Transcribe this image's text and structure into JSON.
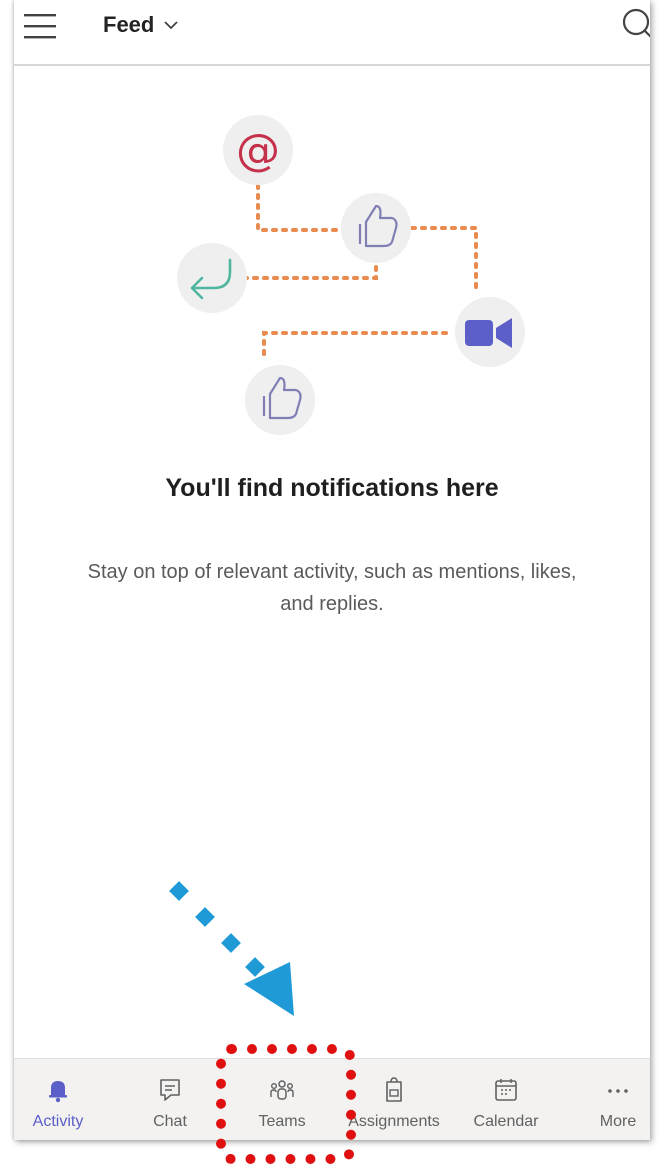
{
  "header": {
    "title": "Feed"
  },
  "empty_state": {
    "title": "You'll find notifications here",
    "description": "Stay on top of relevant activity, such as mentions, likes, and replies."
  },
  "tabs": [
    {
      "label": "Activity",
      "icon": "bell-icon",
      "active": true
    },
    {
      "label": "Chat",
      "icon": "chat-icon",
      "active": false
    },
    {
      "label": "Teams",
      "icon": "teams-icon",
      "active": false
    },
    {
      "label": "Assignments",
      "icon": "assignments-icon",
      "active": false
    },
    {
      "label": "Calendar",
      "icon": "calendar-icon",
      "active": false
    },
    {
      "label": "More",
      "icon": "more-icon",
      "active": false
    }
  ],
  "colors": {
    "accent": "#5b5fc7",
    "mention": "#c4314b",
    "reply": "#4fb7a0",
    "connector": "#e98a4f",
    "highlight": "#e01010",
    "pointer": "#1f9ad6"
  }
}
